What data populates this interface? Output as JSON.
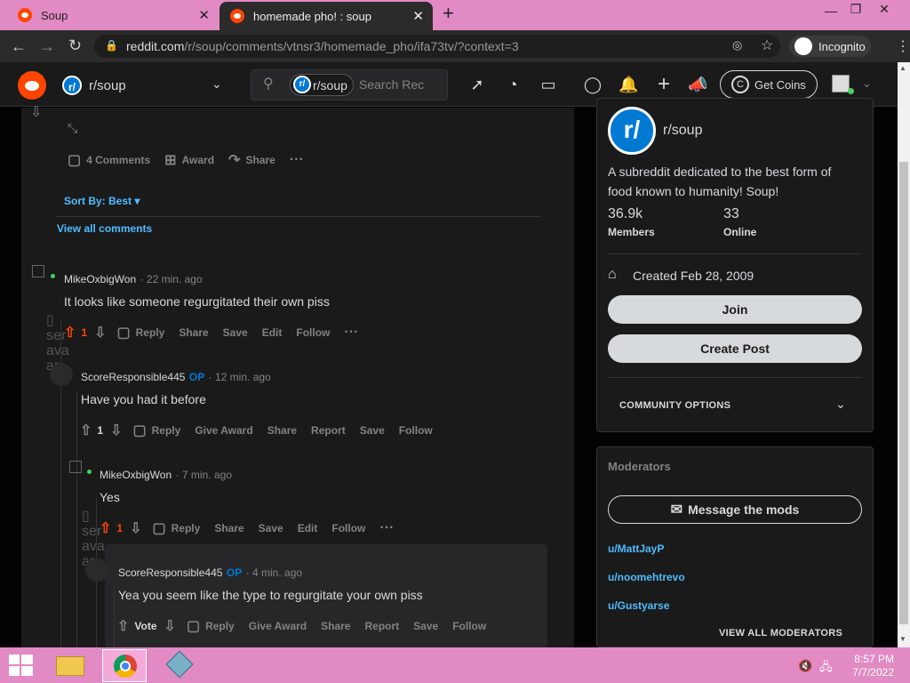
{
  "browser": {
    "tabs": [
      {
        "title": "Soup"
      },
      {
        "title": "homemade pho! : soup"
      }
    ],
    "url_host": "reddit.com",
    "url_path": "/r/soup/comments/vtnsr3/homemade_pho/ifa73tv/?context=3",
    "incognito_label": "Incognito"
  },
  "header": {
    "subreddit_icon": "r/",
    "subreddit": "r/soup",
    "search_chip": "r/soup",
    "search_placeholder": "Search Rec",
    "get_coins": "Get Coins"
  },
  "post": {
    "comments_count": "4 Comments",
    "award": "Award",
    "share": "Share",
    "sort_label": "Sort By: Best",
    "view_all": "View all comments"
  },
  "comments": [
    {
      "author": "MikeOxbigWon",
      "time": "· 22 min. ago",
      "text": "It looks like someone regurgitated their own piss",
      "votes": "1",
      "actions": [
        "Reply",
        "Share",
        "Save",
        "Edit",
        "Follow"
      ],
      "avatar_alt": "User avatar"
    },
    {
      "author": "ScoreResponsible445",
      "op": "OP",
      "time": "· 12 min. ago",
      "text": "Have you had it before",
      "votes": "1",
      "actions": [
        "Reply",
        "Give Award",
        "Share",
        "Report",
        "Save",
        "Follow"
      ]
    },
    {
      "author": "MikeOxbigWon",
      "time": "· 7 min. ago",
      "text": "Yes",
      "votes": "1",
      "actions": [
        "Reply",
        "Share",
        "Save",
        "Edit",
        "Follow"
      ],
      "avatar_alt": "User avatar"
    },
    {
      "author": "ScoreResponsible445",
      "op": "OP",
      "time": "· 4 min. ago",
      "text": "Yea you seem like the type to regurgitate your own piss",
      "votes": "Vote",
      "actions": [
        "Reply",
        "Give Award",
        "Share",
        "Report",
        "Save",
        "Follow"
      ]
    }
  ],
  "sidebar": {
    "community": {
      "icon": "r/",
      "name": "r/soup",
      "description_l1": "A subreddit dedicated to the best form of",
      "description_l2": "food known to humanity! Soup!",
      "members": "36.9k",
      "members_label": "Members",
      "online": "33",
      "online_label": "Online",
      "created": "Created Feb 28, 2009",
      "join": "Join",
      "create_post": "Create Post",
      "options": "COMMUNITY OPTIONS"
    },
    "moderators": {
      "title": "Moderators",
      "message_btn": "Message the mods",
      "list": [
        "u/MattJayP",
        "u/noomehtrevo",
        "u/Gustyarse"
      ],
      "view_all": "VIEW ALL MODERATORS"
    }
  },
  "taskbar": {
    "time": "8:57 PM",
    "date": "7/7/2022"
  },
  "colors": {
    "reddit_orange": "#ff4500",
    "link_blue": "#4fbcff",
    "chrome_pink": "#e28ac4"
  }
}
